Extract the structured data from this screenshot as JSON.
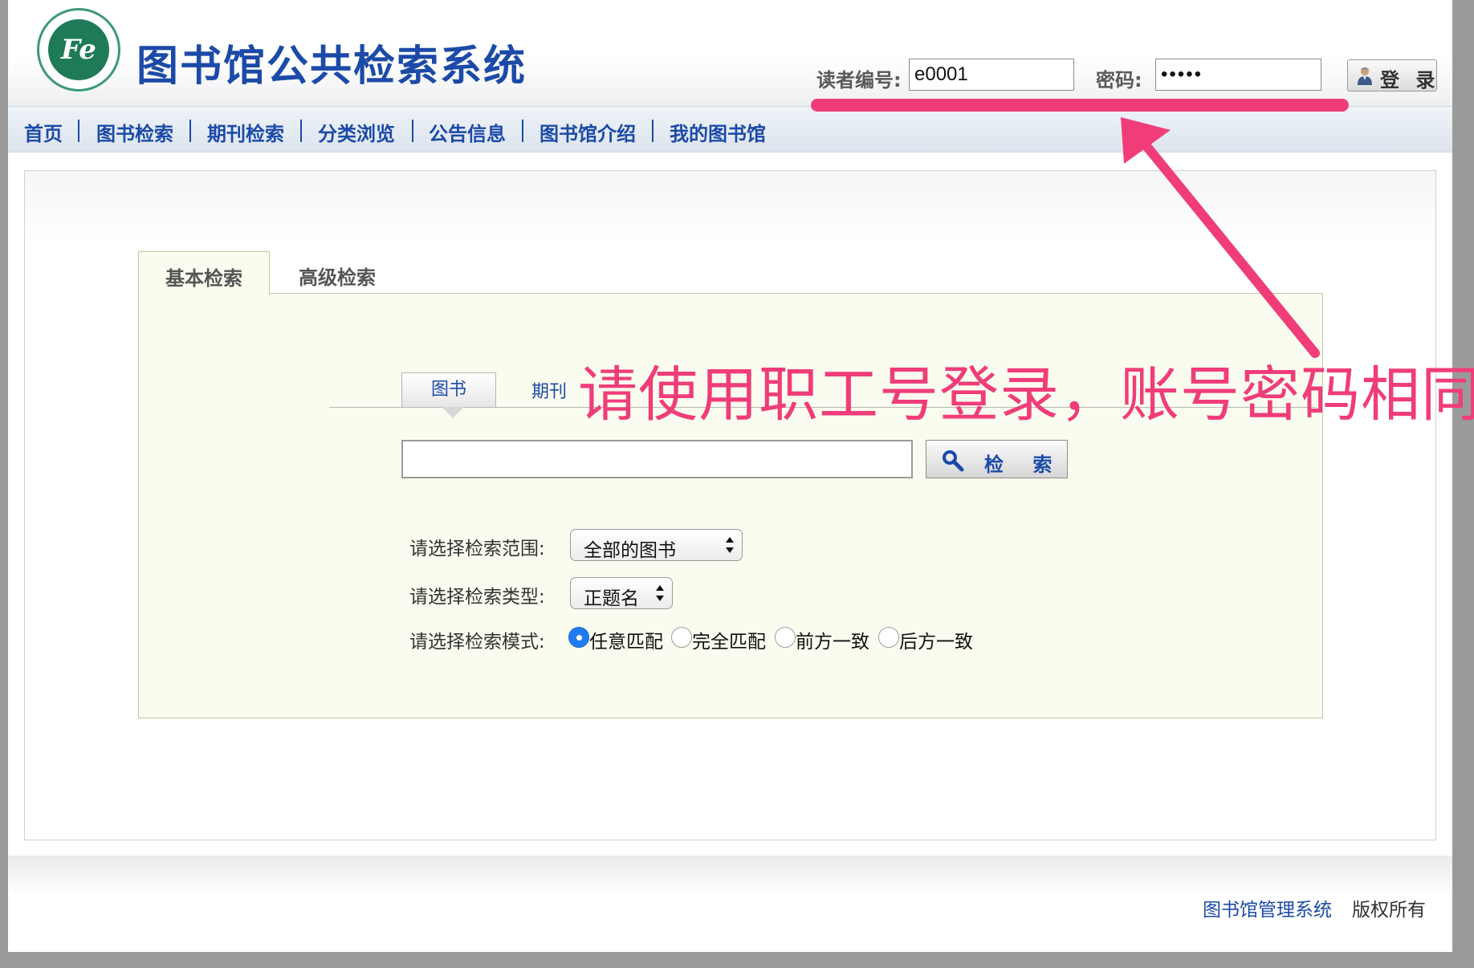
{
  "header": {
    "logo_text": "Fe",
    "title": "图书馆公共检索系统",
    "reader_id_label": "读者编号:",
    "reader_id_value": "e0001",
    "password_label": "密码:",
    "password_value": "•••••",
    "login_button": "登 录"
  },
  "nav": {
    "items": [
      {
        "label": "首页"
      },
      {
        "label": "图书检索"
      },
      {
        "label": "期刊检索"
      },
      {
        "label": "分类浏览"
      },
      {
        "label": "公告信息"
      },
      {
        "label": "图书馆介绍"
      },
      {
        "label": "我的图书馆"
      }
    ]
  },
  "search": {
    "tabs": [
      {
        "label": "基本检索"
      },
      {
        "label": "高级检索"
      }
    ],
    "sub_tabs": [
      {
        "label": "图书"
      },
      {
        "label": "期刊"
      }
    ],
    "query_value": "",
    "search_button": "检 索",
    "scope_label": "请选择检索范围:",
    "scope_value": "全部的图书",
    "type_label": "请选择检索类型:",
    "type_value": "正题名",
    "mode_label": "请选择检索模式:",
    "modes": [
      {
        "label": "任意匹配",
        "selected": true
      },
      {
        "label": "完全匹配",
        "selected": false
      },
      {
        "label": "前方一致",
        "selected": false
      },
      {
        "label": "后方一致",
        "selected": false
      }
    ]
  },
  "footer": {
    "link": "图书馆管理系统",
    "text": "版权所有"
  },
  "annotation": {
    "text": "请使用职工号登录，账号密码相同",
    "color": "#f03d7a"
  },
  "colors": {
    "brand_blue": "#1c4aa8",
    "panel_bg": "#fafcef",
    "radio_selected": "#1f7cf0"
  }
}
